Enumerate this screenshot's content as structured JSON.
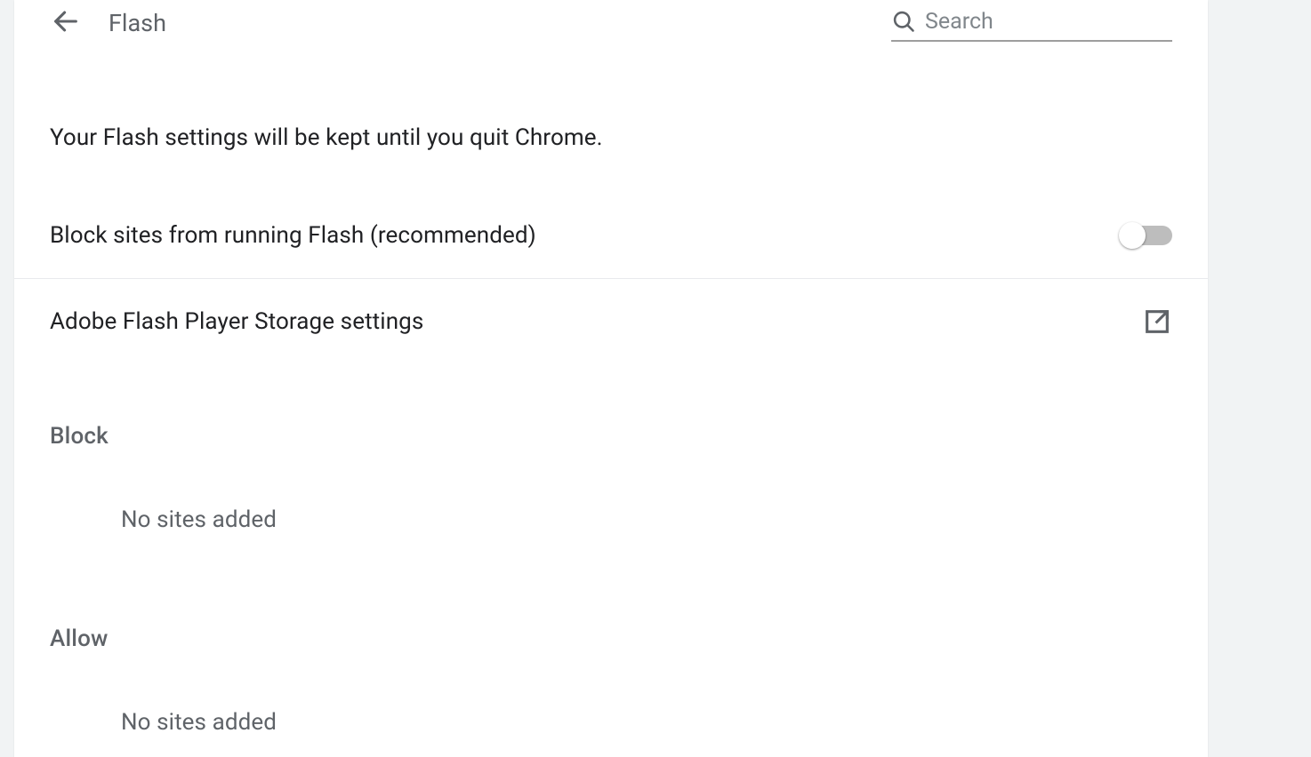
{
  "header": {
    "title": "Flash",
    "search_placeholder": "Search"
  },
  "info_notice": "Your Flash settings will be kept until you quit Chrome.",
  "block_toggle": {
    "label": "Block sites from running Flash (recommended)",
    "state": "off"
  },
  "storage_link": {
    "label": "Adobe Flash Player Storage settings"
  },
  "sections": {
    "block": {
      "title": "Block",
      "empty_text": "No sites added"
    },
    "allow": {
      "title": "Allow",
      "empty_text": "No sites added"
    }
  }
}
